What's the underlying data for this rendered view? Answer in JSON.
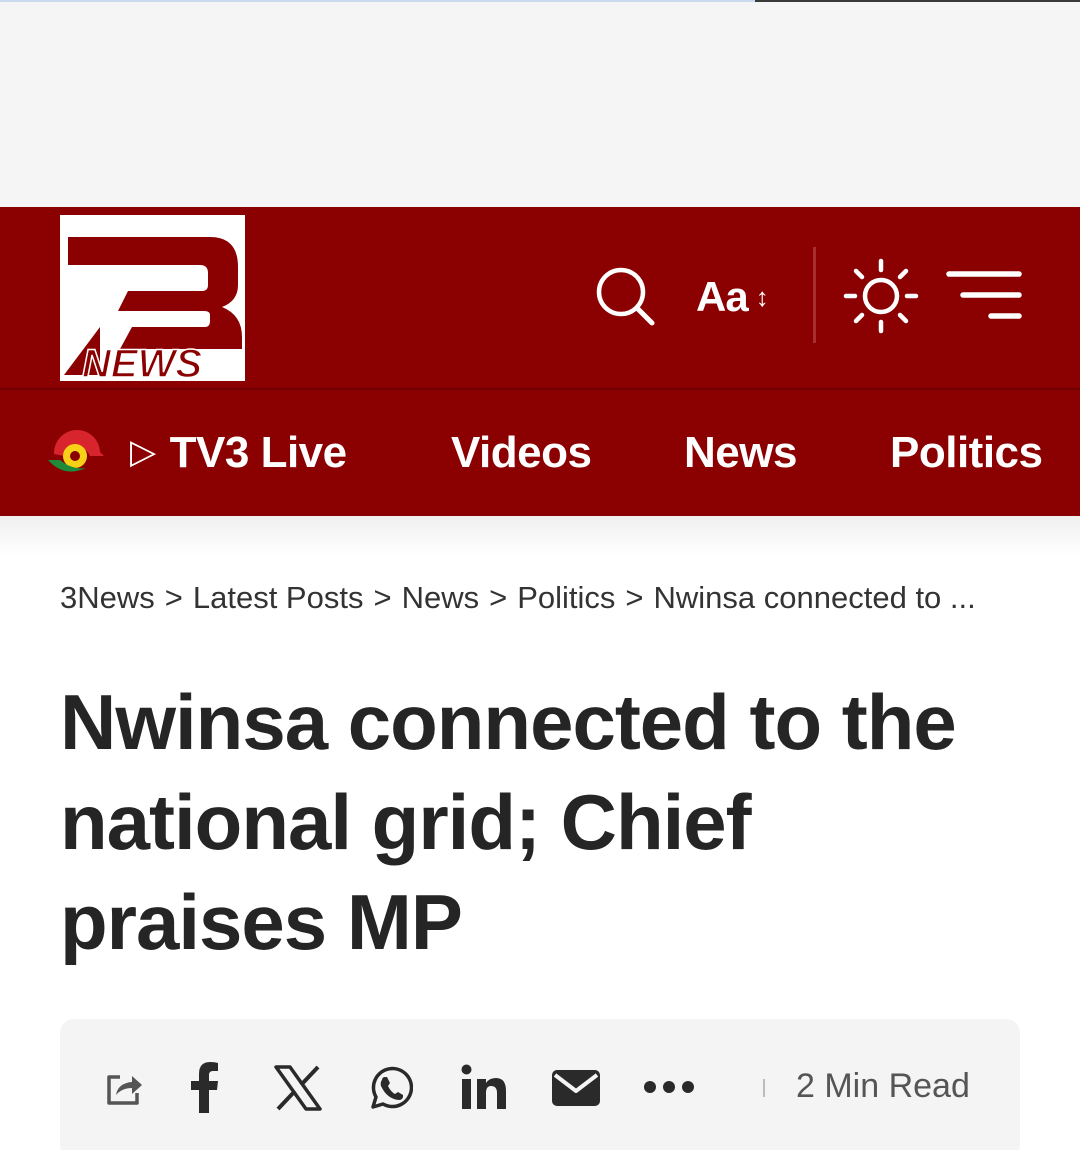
{
  "header": {
    "logo_text": "NEWS",
    "font_size_label": "Aa",
    "font_size_arrow": "↕"
  },
  "nav": {
    "items": [
      {
        "label": "TV3 Live",
        "icon": "play-icon"
      },
      {
        "label": "Videos"
      },
      {
        "label": "News"
      },
      {
        "label": "Politics"
      }
    ]
  },
  "breadcrumb": {
    "items": [
      "3News",
      "Latest Posts",
      "News",
      "Politics",
      "Nwinsa connected to ..."
    ],
    "separator": ">"
  },
  "article": {
    "title": "Nwinsa connected to the national grid; Chief praises MP"
  },
  "share_bar": {
    "icons": [
      "share-icon",
      "facebook-icon",
      "x-icon",
      "whatsapp-icon",
      "linkedin-icon",
      "mail-icon",
      "more-icon"
    ],
    "read_time": "2 Min Read"
  },
  "colors": {
    "brand_red": "#8b0000",
    "text_dark": "#252525",
    "share_bar_bg": "#f4f4f5"
  }
}
